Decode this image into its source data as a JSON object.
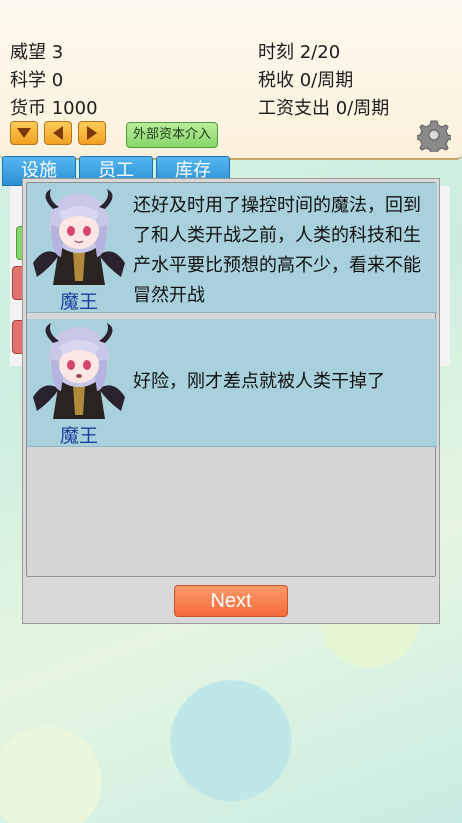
{
  "stats": {
    "prestige": "威望 3",
    "science": "科学 0",
    "currency": "货币 1000",
    "time": "时刻 2/20",
    "tax": "税收 0/周期",
    "wages": "工资支出 0/周期"
  },
  "controls": {
    "capital_label": "外部资本介入",
    "accent": "#f0a020"
  },
  "tabs": [
    "设施",
    "员工",
    "库存"
  ],
  "dialog": {
    "messages": [
      {
        "speaker": "魔王",
        "text": "还好及时用了操控时间的魔法，回到了和人类开战之前，人类的科技和生产水平要比预想的高不少，看来不能冒然开战"
      },
      {
        "speaker": "魔王",
        "text": "好险，刚才差点就被人类干掉了"
      }
    ],
    "next_label": "Next"
  }
}
